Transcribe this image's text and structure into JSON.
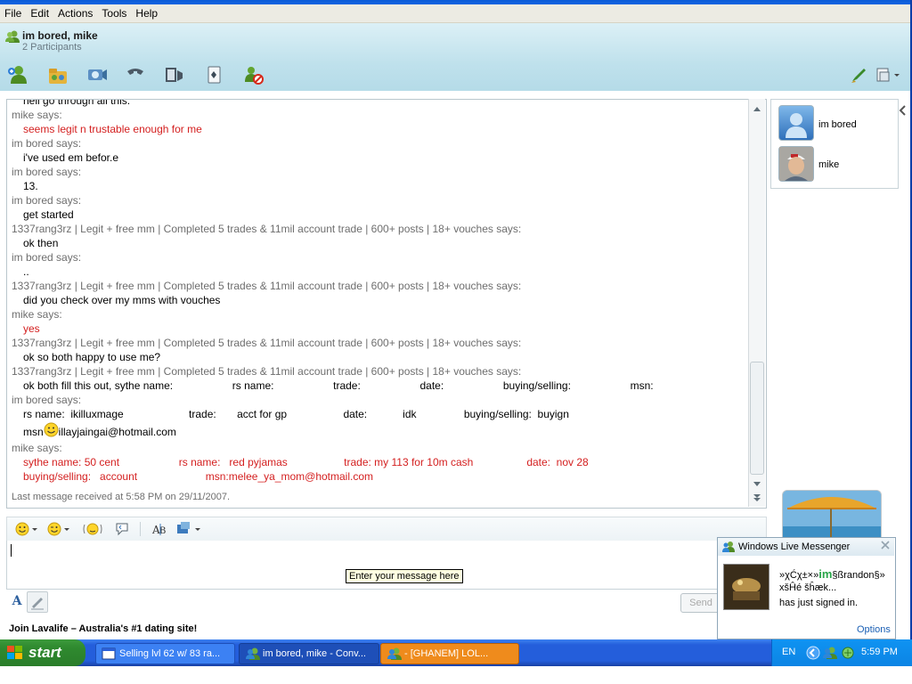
{
  "menu": [
    "File",
    "Edit",
    "Actions",
    "Tools",
    "Help"
  ],
  "conversation": {
    "title": "im bored, mike",
    "participants": "2 Participants"
  },
  "toolbar": {
    "icons": [
      "invite-icon",
      "share-files-icon",
      "video-call-icon",
      "phone-call-icon",
      "activities-icon",
      "games-icon",
      "block-icon"
    ],
    "right_icons": [
      "paint-brush-icon",
      "display-options-icon"
    ]
  },
  "history": [
    {
      "sender": "",
      "text": "hell go through all this.",
      "color": "black"
    },
    {
      "sender": "mike says:",
      "text": "seems legit n trustable enough for me",
      "color": "red"
    },
    {
      "sender": "im bored says:",
      "text": "i've used em befor.e",
      "color": "black"
    },
    {
      "sender": "im bored says:",
      "text": "13.",
      "color": "black"
    },
    {
      "sender": "im bored says:",
      "text": "get started",
      "color": "black"
    },
    {
      "sender": "1337rang3rz | Legit + free mm | Completed 5 trades & 11mil account trade | 600+ posts | 18+ vouches says:",
      "text": "ok then",
      "color": "black"
    },
    {
      "sender": "im bored says:",
      "text": "..",
      "color": "black"
    },
    {
      "sender": "1337rang3rz | Legit + free mm | Completed 5 trades & 11mil account trade | 600+ posts | 18+ vouches says:",
      "text": "did you check over my mms with vouches",
      "color": "black"
    },
    {
      "sender": "mike says:",
      "text": "yes",
      "color": "red"
    },
    {
      "sender": "1337rang3rz | Legit + free mm | Completed 5 trades & 11mil account trade | 600+ posts | 18+ vouches says:",
      "text": "ok so both happy to use me?",
      "color": "black"
    },
    {
      "sender": "1337rang3rz | Legit + free mm | Completed 5 trades & 11mil account trade | 600+ posts | 18+ vouches says:",
      "text": "ok both fill this out, sythe name:                    rs name:                    trade:                    date:                    buying/selling:                    msn:",
      "color": "black"
    },
    {
      "sender": "im bored says:",
      "text": "rs name:  ikilluxmage                      trade:       acct for gp                   date:            idk                buying/selling:  buyign",
      "color": "black"
    },
    {
      "sender": "",
      "text": "msn",
      "text2": "illayjaingai@hotmail.com",
      "color": "black"
    },
    {
      "sender": "mike says:",
      "text": "sythe name: 50 cent                    rs name:   red pyjamas                   trade: my 113 for 10m cash                  date:  nov 28",
      "color": "red"
    },
    {
      "sender": "",
      "text": "buying/selling:   account                       msn:melee_ya_mom@hotmail.com",
      "color": "red"
    }
  ],
  "status": {
    "last_message": "Last message received at 5:58 PM on 29/11/2007."
  },
  "compose": {
    "tooltip": "Enter your message here",
    "send": "Send",
    "font_label": "A"
  },
  "ad": {
    "text": "Join Lavalife – Australia's #1 dating site!"
  },
  "participants_list": [
    {
      "name": "im bored"
    },
    {
      "name": "mike"
    }
  ],
  "toast": {
    "title": "Windows Live Messenger",
    "name_line1": "»χĆχ±×»",
    "name_brand": "im",
    "name_rest": "§ßrandon§»",
    "name_line2": "xšĤé šĥæk...",
    "subtitle": "has just signed in.",
    "options": "Options"
  },
  "taskbar": {
    "start": "start",
    "tasks": [
      "Selling lvl 62 w/ 83 ra...",
      "im bored, mike - Conv...",
      "-  [GHANEM]     LOL..."
    ],
    "lang": "EN",
    "clock": "5:59 PM"
  }
}
